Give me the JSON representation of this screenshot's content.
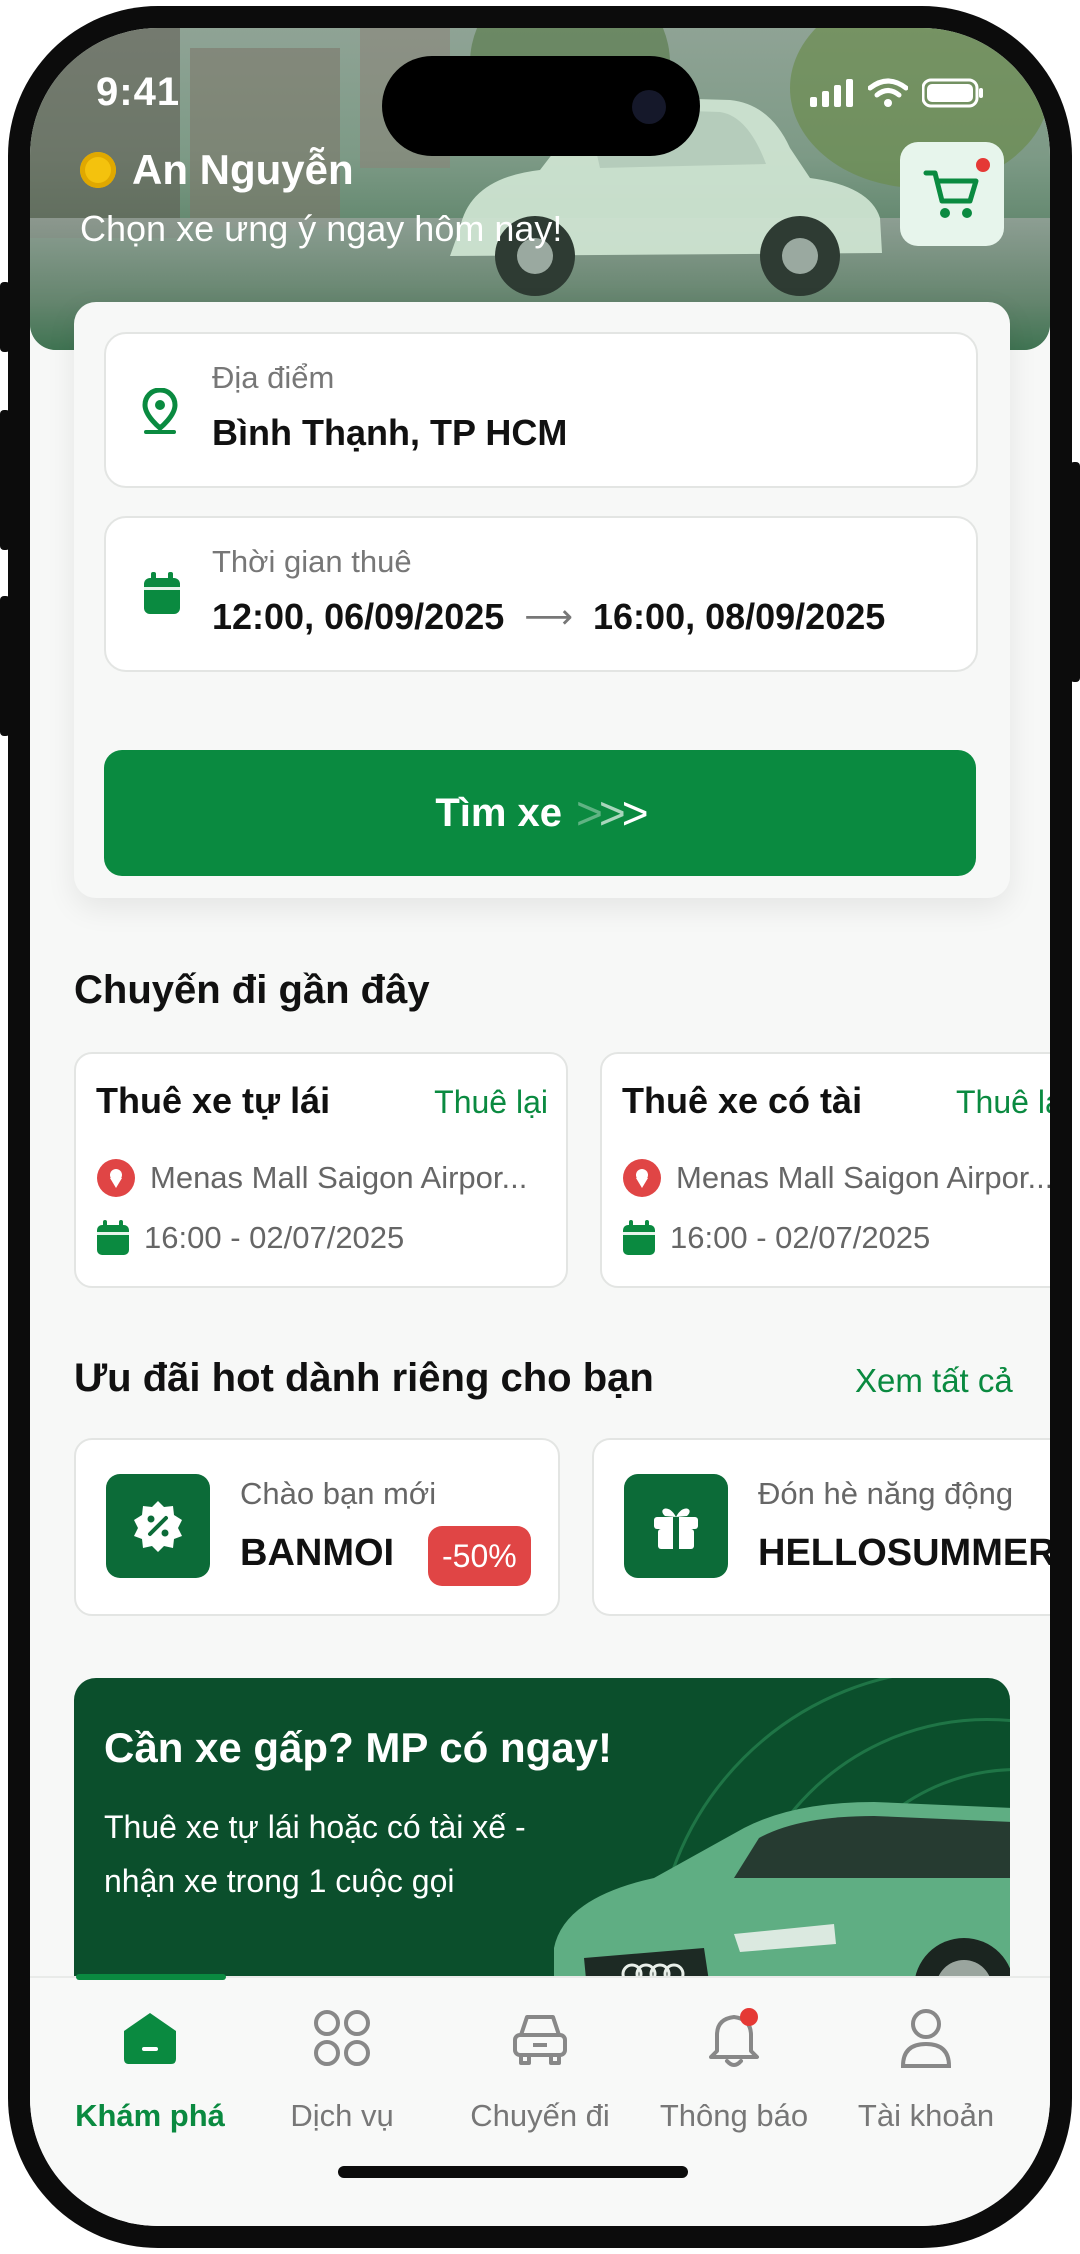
{
  "status_bar": {
    "time": "9:41",
    "icons": [
      "signal-icon",
      "wifi-icon",
      "battery-icon"
    ]
  },
  "header": {
    "user_name": "An Nguyễn",
    "tagline": "Chọn xe ưng ý ngay hôm nay!",
    "cart_icon": "cart-icon"
  },
  "search": {
    "location_label": "Địa điểm",
    "location_value": "Bình Thạnh, TP HCM",
    "time_label": "Thời gian thuê",
    "time_start": "12:00, 06/09/2025",
    "time_end": "16:00, 08/09/2025",
    "button_label": "Tìm xe"
  },
  "recent": {
    "title": "Chuyến đi gần đây",
    "trips": [
      {
        "title": "Thuê xe tự lái",
        "action": "Thuê lại",
        "location": "Menas Mall Saigon Airpor...",
        "datetime": "16:00 - 02/07/2025"
      },
      {
        "title": "Thuê xe có tài",
        "action": "Thuê lại",
        "location": "Menas Mall Saigon Airpor...",
        "datetime": "16:00 - 02/07/2025"
      }
    ]
  },
  "promos": {
    "title": "Ưu đãi hot dành riêng cho bạn",
    "see_all": "Xem tất cả",
    "items": [
      {
        "label": "Chào bạn mới",
        "code": "BANMOI",
        "badge": "-50%",
        "icon": "discount-badge-icon"
      },
      {
        "label": "Đón hè năng động",
        "code": "HELLOSUMMER",
        "icon": "gift-icon"
      }
    ]
  },
  "banner": {
    "title": "Cần xe gấp? MP có ngay!",
    "subtitle": "Thuê xe tự lái hoặc có tài xế - nhận xe trong 1 cuộc gọi"
  },
  "tabbar": {
    "active": "Khám phá",
    "tabs": [
      {
        "label": "Khám phá",
        "icon": "home-icon"
      },
      {
        "label": "Dịch vụ",
        "icon": "grid-icon"
      },
      {
        "label": "Chuyến đi",
        "icon": "car-icon"
      },
      {
        "label": "Thông báo",
        "icon": "bell-icon"
      },
      {
        "label": "Tài khoản",
        "icon": "user-icon"
      }
    ]
  },
  "colors": {
    "primary": "#0a8a40",
    "dark_green": "#0b4f2c",
    "badge_red": "#e04545",
    "notification_dot": "#e53935"
  }
}
